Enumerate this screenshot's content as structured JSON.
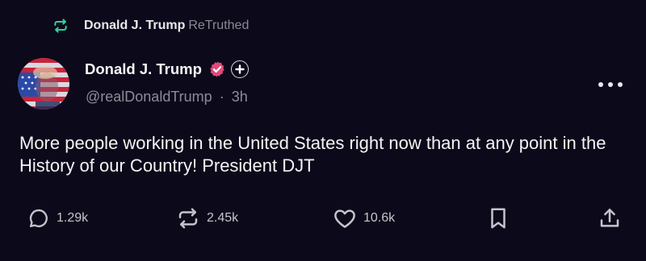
{
  "retruth": {
    "icon": "retruth-icon",
    "name": "Donald J. Trump",
    "label": "ReTruthed"
  },
  "post": {
    "author": {
      "display_name": "Donald J. Trump",
      "handle": "@realDonaldTrump",
      "separator": "·",
      "time": "3h",
      "verified_icon": "verified-badge-icon",
      "plus_icon": "plus-badge-icon",
      "avatar": "avatar-flag-portrait"
    },
    "text": "More people working in the United States right now than at any point in the History of our Country! President DJT"
  },
  "actions": {
    "reply": {
      "icon": "reply-icon",
      "count": "1.29k"
    },
    "retruth": {
      "icon": "retruth-icon",
      "count": "2.45k"
    },
    "like": {
      "icon": "heart-icon",
      "count": "10.6k"
    },
    "bookmark": {
      "icon": "bookmark-icon"
    },
    "share": {
      "icon": "share-icon"
    },
    "more": {
      "icon": "more-horizontal-icon"
    }
  },
  "colors": {
    "background": "#0c0a1a",
    "text_primary": "#f4f4f6",
    "text_secondary": "#8c8c98",
    "retruth_accent": "#2fd39a",
    "verified_accent": "#e04a7a"
  }
}
